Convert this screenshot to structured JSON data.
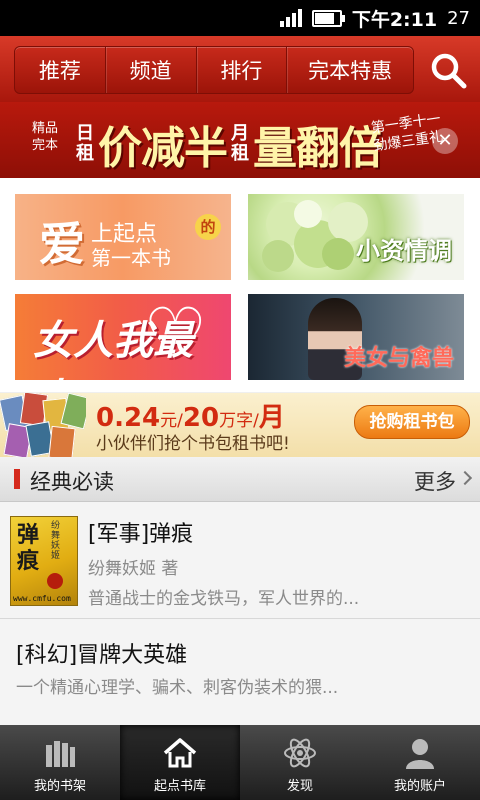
{
  "status_bar": {
    "time": "下午2:11",
    "extra": "27",
    "battery_level": 0.85
  },
  "nav_tabs": [
    "推荐",
    "频道",
    "排行",
    "完本特惠"
  ],
  "promo": {
    "tag_line1": "精品",
    "tag_line2": "完本",
    "small1": "日租",
    "text1": "价减半",
    "small2": "月租",
    "text2": "量翻倍",
    "side_text": "第一季十一劲爆三重礼"
  },
  "tiles": [
    {
      "big": "爱",
      "line1": "上起点",
      "de": "的",
      "line2": "第一本书"
    },
    {
      "caption": "小资情调"
    },
    {
      "caption": "女人我最大"
    },
    {
      "caption": "美女与禽兽"
    }
  ],
  "rent": {
    "price": "0.24",
    "unit1": "元/",
    "amount": "20",
    "unit2": "万字/",
    "period": "月",
    "slogan": "小伙伴们抢个书包租书吧!",
    "button": "抢购租书包"
  },
  "section": {
    "title": "经典必读",
    "more": "更多"
  },
  "books": [
    {
      "title": "[军事]弹痕",
      "author": "纷舞妖姬 著",
      "desc": "普通战士的金戈铁马，军人世界的...",
      "cover_title": "弹痕",
      "cover_author": "纷舞妖姬",
      "cover_url": "www.cmfu.com"
    },
    {
      "title": "[科幻]冒牌大英雄",
      "desc": "一个精通心理学、骗术、刺客伪装术的猥..."
    }
  ],
  "bottom_nav": [
    {
      "label": "我的书架",
      "icon": "bookshelf-icon"
    },
    {
      "label": "起点书库",
      "icon": "home-icon"
    },
    {
      "label": "发现",
      "icon": "atom-icon"
    },
    {
      "label": "我的账户",
      "icon": "user-icon"
    }
  ],
  "colors": {
    "brand_red": "#c1231a",
    "accent_orange": "#ec7a12"
  }
}
